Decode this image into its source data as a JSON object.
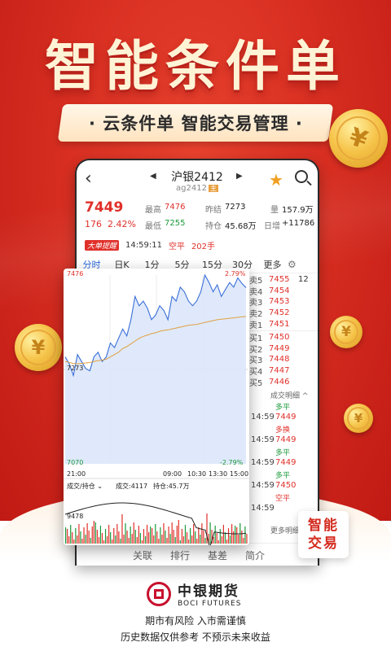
{
  "promo": {
    "headline": "智能条件单",
    "tagline": "· 云条件单  智能交易管理 ·",
    "badge_line1": "智能",
    "badge_line2": "交易"
  },
  "coin_symbol": "¥",
  "header": {
    "back_icon": "‹",
    "prev_icon": "◀",
    "next_icon": "▶",
    "title": "沪银2412",
    "subtitle": "ag2412",
    "subtitle_badge": "主"
  },
  "quote": {
    "price": "7449",
    "change": "176",
    "change_pct": "2.42%",
    "high_label": "最高",
    "high": "7476",
    "low_label": "最低",
    "low": "7255",
    "prev_label": "昨结",
    "prev": "7273",
    "oi_label": "持仓",
    "oi": "45.68万",
    "vol_label": "量",
    "vol": "157.9万",
    "day_inc_label": "日增",
    "day_inc": "+11786"
  },
  "alert": {
    "tag": "大单提醒",
    "time": "14:59:11",
    "type": "空平",
    "qty": "202手"
  },
  "periods": [
    "分时",
    "日K",
    "1分",
    "5分",
    "15分",
    "30分",
    "更多"
  ],
  "order_book": [
    {
      "label": "卖5",
      "price": "7455",
      "vol": "12"
    },
    {
      "label": "卖4",
      "price": "7454",
      "vol": ""
    },
    {
      "label": "卖3",
      "price": "7453",
      "vol": ""
    },
    {
      "label": "卖2",
      "price": "7452",
      "vol": ""
    },
    {
      "label": "卖1",
      "price": "7451",
      "vol": ""
    },
    {
      "label": "买1",
      "price": "7450",
      "vol": ""
    },
    {
      "label": "买2",
      "price": "7449",
      "vol": ""
    },
    {
      "label": "买3",
      "price": "7448",
      "vol": ""
    },
    {
      "label": "买4",
      "price": "7447",
      "vol": ""
    },
    {
      "label": "买5",
      "price": "7446",
      "vol": ""
    }
  ],
  "tick_header": "成交明细 ^",
  "ticks": [
    {
      "kind": "多平",
      "time": "14:59",
      "price": "7449"
    },
    {
      "kind": "多换",
      "time": "14:59",
      "price": "7449"
    },
    {
      "kind": "多平",
      "time": "14:59",
      "price": "7449"
    },
    {
      "kind": "多平",
      "time": "14:59",
      "price": "7450"
    },
    {
      "kind": "空平",
      "time": "14:59",
      "price": ""
    }
  ],
  "more_ticks": "更多明细",
  "tabs": [
    "关联",
    "排行",
    "基差",
    "简介"
  ],
  "chart_card": {
    "top_left": "7476",
    "top_right": "2.79%",
    "mid_left": "7273",
    "bottom_left": "7070",
    "bottom_right": "-2.79%",
    "time_labels": [
      "21:00",
      "09:00",
      "10:30",
      "13:30",
      "15:00"
    ],
    "vol_label": "成交/持仓 ⌄",
    "vol_value": "成交:4117",
    "oi_value": "持仓:45.7万",
    "vol_axis": "9478"
  },
  "chart_data": {
    "type": "line",
    "title": "",
    "ylim": [
      7070,
      7476
    ],
    "series": [
      {
        "values": [
          7300,
          7285,
          7260,
          7305,
          7290,
          7275,
          7270,
          7300,
          7310,
          7290,
          7300,
          7330,
          7320,
          7340,
          7360,
          7345,
          7380,
          7430,
          7410,
          7420,
          7405,
          7380,
          7390,
          7410,
          7400,
          7380,
          7430,
          7420,
          7450,
          7440,
          7420,
          7410,
          7420,
          7440,
          7476,
          7460,
          7440,
          7455,
          7430,
          7445,
          7460,
          7450,
          7470,
          7458,
          7449
        ]
      },
      {
        "values": [
          7290,
          7288,
          7286,
          7285,
          7286,
          7287,
          7288,
          7290,
          7292,
          7293,
          7295,
          7300,
          7305,
          7310,
          7318,
          7322,
          7328,
          7334,
          7340,
          7344,
          7347,
          7350,
          7352,
          7355,
          7357,
          7358,
          7360,
          7362,
          7364,
          7366,
          7368,
          7369,
          7370,
          7372,
          7374,
          7376,
          7378,
          7380,
          7381,
          7382,
          7383,
          7384,
          7385,
          7386,
          7387
        ]
      }
    ]
  },
  "brand": {
    "name_cn": "中银期货",
    "name_en": "BOCI FUTURES"
  },
  "disclaimer": {
    "line1": "期市有风险 入市需谨慎",
    "line2": "历史数据仅供参考 不预示未来收益"
  }
}
